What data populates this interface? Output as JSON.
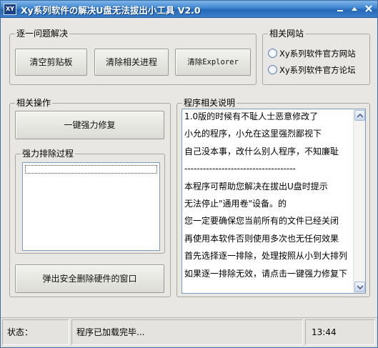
{
  "window": {
    "title": "Xy系列软件の解决U盘无法拔出小工具 V2.0",
    "icon_text": "XY"
  },
  "groups": {
    "problem": {
      "legend": "逐一问题解决",
      "buttons": [
        "清空剪贴板",
        "清除相关进程",
        "清除Explorer"
      ]
    },
    "links": {
      "legend": "相关网站",
      "radios": [
        "Xy系列软件官方网站",
        "Xy系列软件官方论坛"
      ]
    },
    "ops": {
      "legend": "相关操作",
      "force_button": "一键强力修复",
      "exclude_legend": "强力排除过程",
      "eject_button": "弹出安全删除硬件的窗口"
    },
    "desc": {
      "legend": "程序相关说明",
      "lines": [
        "1.0版的时候有不耻人士恶意修改了",
        "小允的程序，小允在这里强烈鄙视下",
        "自己没本事，改什么别人程序，不知廉耻",
        "------------------------------------",
        "本程序可帮助您解决在拔出U盘时提示",
        "无法停止\"通用卷\"设备。的",
        "您一定要确保您当前所有的文件已经关闭",
        "再使用本软件否则使用多次也无任何效果",
        "首先选择逐一排除，处理按照从小到大排列",
        "如果逐一排除无效，请点击一键强力修复下"
      ]
    }
  },
  "status": {
    "label": "状态：",
    "message": "程序已加载完毕...",
    "time": "13:44"
  },
  "icons": [
    "app-icon",
    "minimize-icon",
    "maximize-icon",
    "close-icon",
    "scroll-up-icon",
    "scroll-down-icon"
  ],
  "colors": {
    "titlebar": "#2f75c6",
    "face": "#e8e7e3"
  }
}
